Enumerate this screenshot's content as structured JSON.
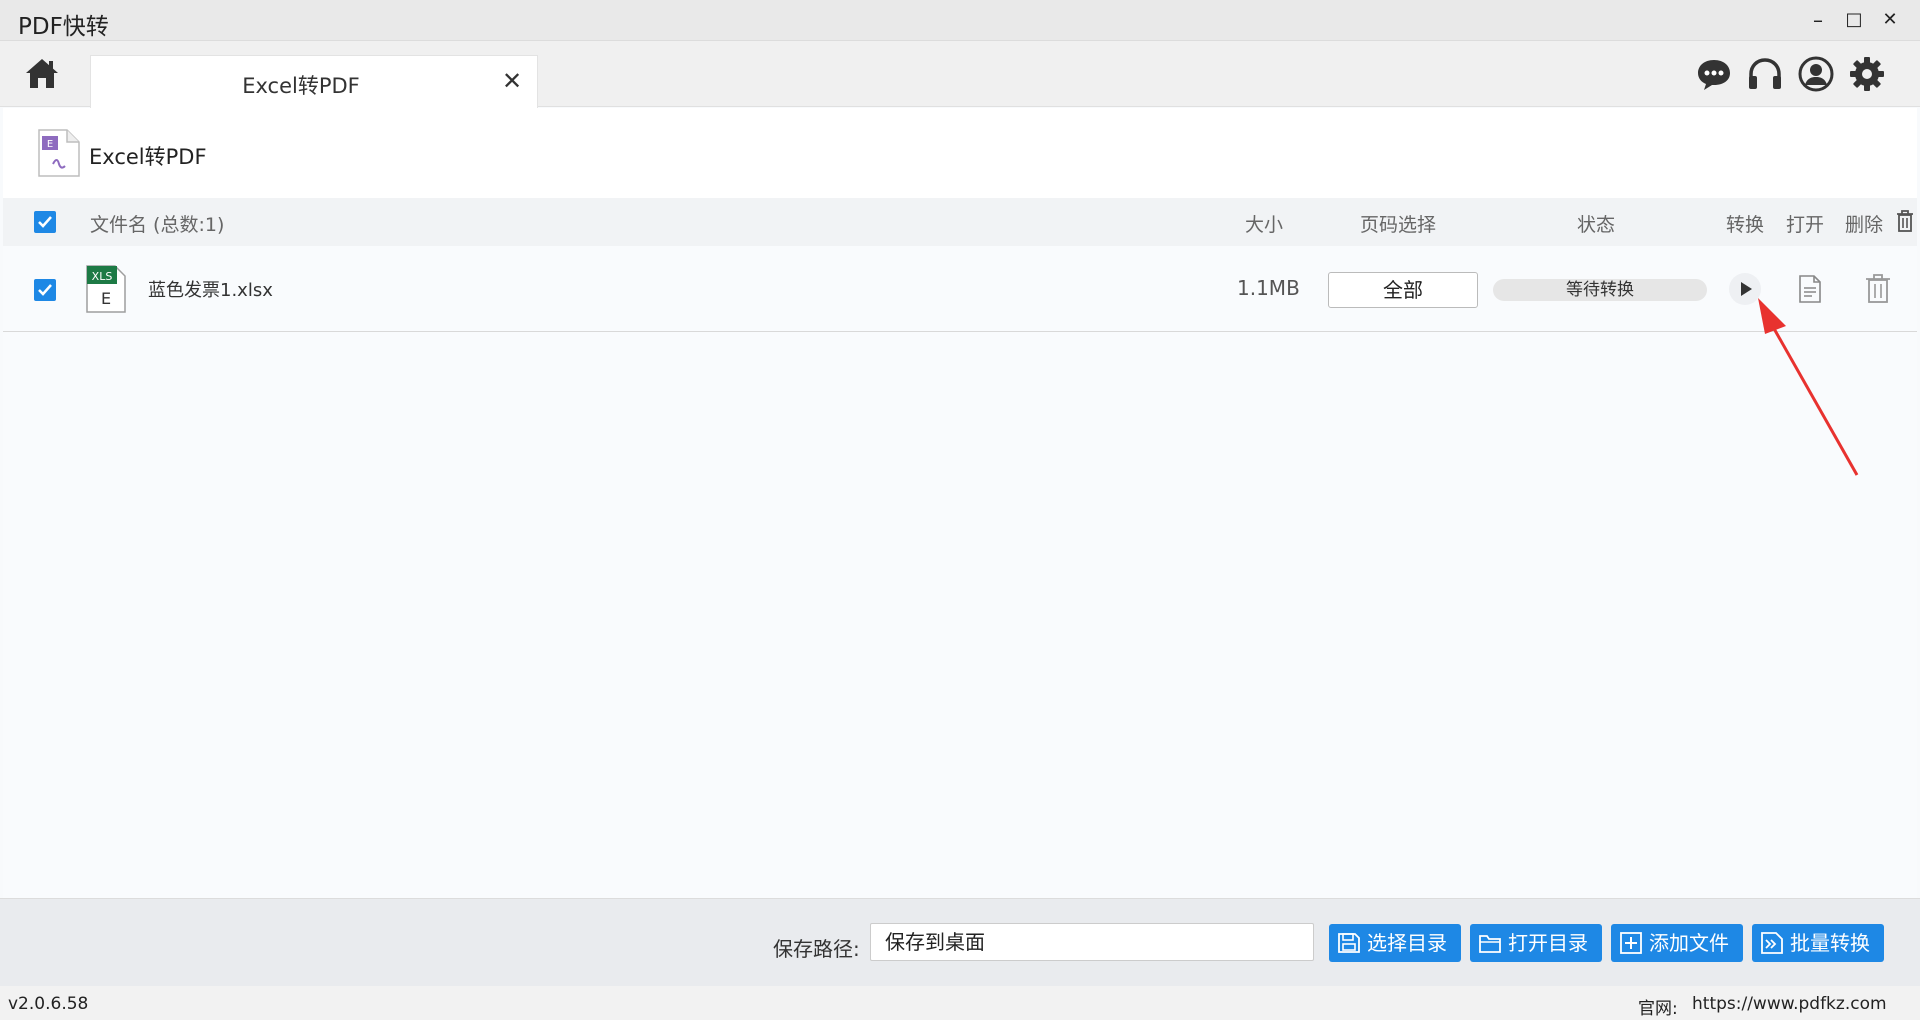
{
  "window": {
    "title": "PDF快转",
    "minimize": "–",
    "maximize": "□",
    "close": "✕"
  },
  "tabs": [
    {
      "label": "Excel转PDF",
      "close": "✕"
    }
  ],
  "toolbar_icons": [
    "chat-icon",
    "headset-icon",
    "user-icon",
    "gear-icon"
  ],
  "function": {
    "title": "Excel转PDF"
  },
  "table": {
    "headers": {
      "filename": "文件名 (总数:1)",
      "size": "大小",
      "page_select": "页码选择",
      "status": "状态",
      "convert": "转换",
      "open": "打开",
      "delete": "删除"
    },
    "rows": [
      {
        "checked": true,
        "name": "蓝色发票1.xlsx",
        "size": "1.1MB",
        "page_select": "全部",
        "status": "等待转换"
      }
    ]
  },
  "file_icon_text": {
    "xls": "XLS",
    "e": "E"
  },
  "bottom": {
    "save_label": "保存路径:",
    "save_value": "保存到桌面",
    "buttons": {
      "choose_dir": "选择目录",
      "open_dir": "打开目录",
      "add_file": "添加文件",
      "batch_convert": "批量转换"
    }
  },
  "footer": {
    "version": "v2.0.6.58",
    "website_label": "官网:",
    "website_url": "https://www.pdfkz.com"
  },
  "colors": {
    "accent": "#1e88e5",
    "excel_green": "#1d7a45",
    "annotation_red": "#e8322f"
  }
}
